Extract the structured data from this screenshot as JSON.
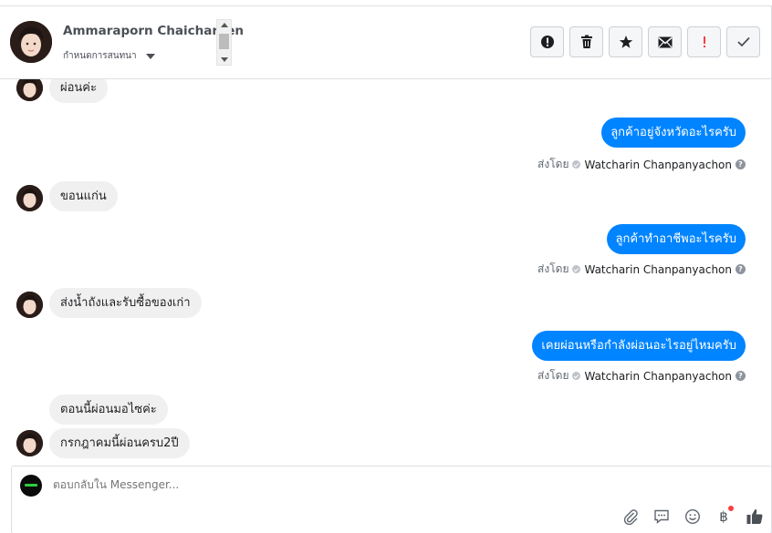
{
  "header": {
    "contact_name": "Ammaraporn Chaicharoen",
    "status_label": "กำหนดการสนทนา"
  },
  "toolbar": {
    "spam_icon": "exclamation-circle-icon",
    "delete_icon": "trash-icon",
    "star_icon": "star-icon",
    "mail_icon": "envelope-icon",
    "important_icon": "exclamation-icon",
    "done_icon": "check-icon",
    "important_color": "#fa3e3e"
  },
  "messages": [
    {
      "direction": "in",
      "text": "ผ่อนค่ะ",
      "avatar": true
    },
    {
      "direction": "out",
      "text": "ลูกค้าอยู่จังหวัดอะไรครับ",
      "sent_by_label": "ส่งโดย",
      "sender": "Watcharin Chanpanyachon"
    },
    {
      "direction": "in",
      "text": "ขอนแก่น",
      "avatar": true
    },
    {
      "direction": "out",
      "text": "ลูกค้าทำอาชีพอะไรครับ",
      "sent_by_label": "ส่งโดย",
      "sender": "Watcharin Chanpanyachon"
    },
    {
      "direction": "in",
      "text": "ส่งน้ำถังและรับซื้อของเก่า",
      "avatar": true
    },
    {
      "direction": "out",
      "text": "เคยผ่อนหรือกำลังผ่อนอะไรอยู่ไหมครับ",
      "sent_by_label": "ส่งโดย",
      "sender": "Watcharin Chanpanyachon"
    },
    {
      "direction": "in",
      "text": "ตอนนี้ผ่อนมอไซค่ะ",
      "avatar": false
    },
    {
      "direction": "in",
      "text": "กรกฎาคมนี้ผ่อนครบ2ปี",
      "avatar": true
    }
  ],
  "composer": {
    "placeholder": "ตอบกลับใน Messenger...",
    "tools": [
      "paperclip-icon",
      "chat-bubble-icon",
      "smiley-icon",
      "baht-icon",
      "thumbs-up-icon"
    ],
    "baht_symbol": "฿",
    "accent_color": "#0084ff"
  }
}
